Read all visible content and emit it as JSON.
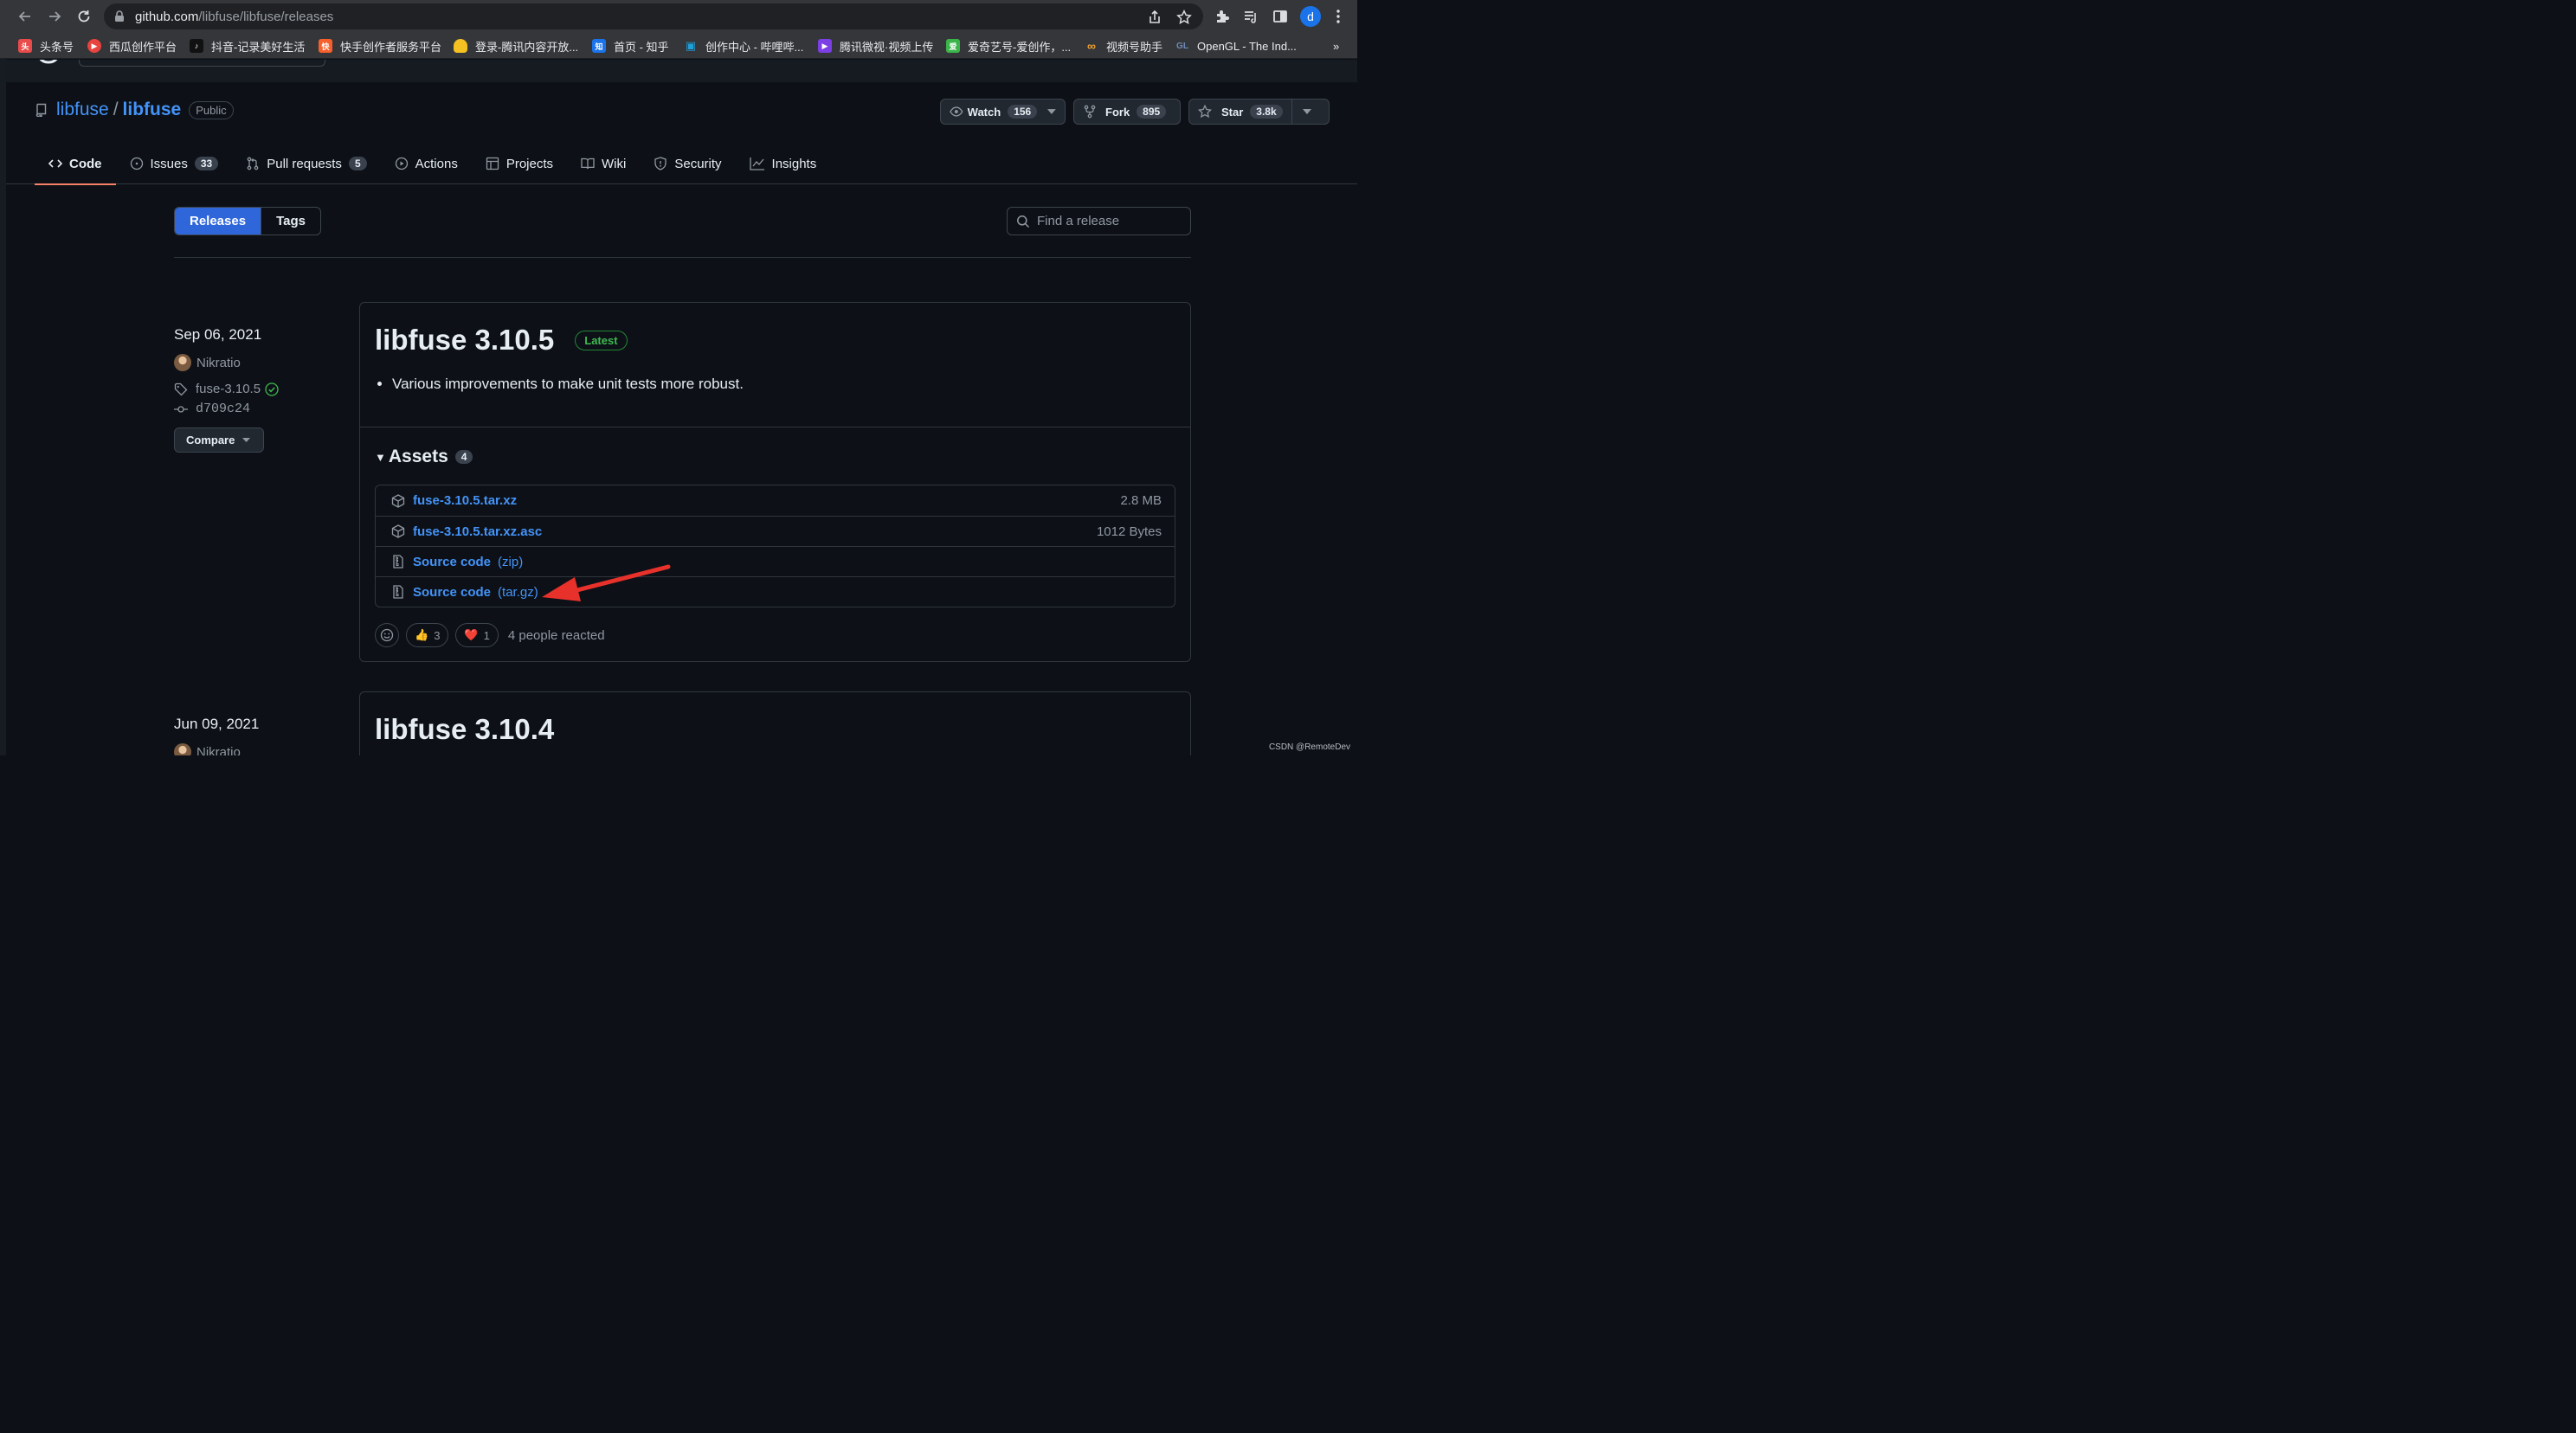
{
  "browser": {
    "url_host": "github.com",
    "url_path": "/libfuse/libfuse/releases",
    "profile_initial": "d",
    "bookmarks": [
      {
        "label": "头条号",
        "color": "#e94b4b",
        "glyph": "头"
      },
      {
        "label": "西瓜创作平台",
        "color": "#e8433e",
        "glyph": "▶"
      },
      {
        "label": "抖音-记录美好生活",
        "color": "#111111",
        "glyph": "♪"
      },
      {
        "label": "快手创作者服务平台",
        "color": "#f7602b",
        "glyph": "快"
      },
      {
        "label": "登录-腾讯内容开放...",
        "color": "#f5c021",
        "glyph": "●"
      },
      {
        "label": "首页 - 知乎",
        "color": "#1a73e8",
        "glyph": "知"
      },
      {
        "label": "创作中心 - 哔哩哔...",
        "color": "#20a0da",
        "glyph": "▣"
      },
      {
        "label": "腾讯微视·视频上传",
        "color": "#7b3fe4",
        "glyph": "▶"
      },
      {
        "label": "爱奇艺号-爱创作，...",
        "color": "#3bb54a",
        "glyph": "爱"
      },
      {
        "label": "视频号助手",
        "color": "#f0a030",
        "glyph": "∞"
      },
      {
        "label": "OpenGL - The Ind...",
        "color": "#6c8bb6",
        "glyph": "GL"
      }
    ],
    "more_bookmarks": "»"
  },
  "repo": {
    "owner": "libfuse",
    "name": "libfuse",
    "visibility": "Public",
    "watch": {
      "label": "Watch",
      "count": "156"
    },
    "fork": {
      "label": "Fork",
      "count": "895"
    },
    "star": {
      "label": "Star",
      "count": "3.8k"
    }
  },
  "tabs": [
    {
      "label": "Code",
      "icon": "code-icon",
      "selected": true
    },
    {
      "label": "Issues",
      "icon": "issue-icon",
      "count": "33"
    },
    {
      "label": "Pull requests",
      "icon": "pull-request-icon",
      "count": "5"
    },
    {
      "label": "Actions",
      "icon": "play-icon"
    },
    {
      "label": "Projects",
      "icon": "table-icon"
    },
    {
      "label": "Wiki",
      "icon": "book-icon"
    },
    {
      "label": "Security",
      "icon": "shield-icon"
    },
    {
      "label": "Insights",
      "icon": "graph-icon"
    }
  ],
  "subnav": {
    "releases": "Releases",
    "tags": "Tags",
    "search_placeholder": "Find a release"
  },
  "releases": [
    {
      "date": "Sep 06, 2021",
      "author": "Nikratio",
      "tag": "fuse-3.10.5",
      "commit": "d709c24",
      "compare": "Compare",
      "title": "libfuse 3.10.5",
      "latest_badge": "Latest",
      "notes": [
        "Various improvements to make unit tests more robust."
      ],
      "assets_label": "Assets",
      "assets_count": "4",
      "assets": [
        {
          "name": "fuse-3.10.5.tar.xz",
          "size": "2.8 MB",
          "icon": "package-icon"
        },
        {
          "name": "fuse-3.10.5.tar.xz.asc",
          "size": "1012 Bytes",
          "icon": "package-icon"
        },
        {
          "name": "Source code",
          "paren": "(zip)",
          "icon": "file-zip-icon"
        },
        {
          "name": "Source code",
          "paren": "(tar.gz)",
          "icon": "file-zip-icon"
        }
      ],
      "reactions": {
        "thumbs_up": "👍",
        "thumbs_up_count": "3",
        "heart": "❤️",
        "heart_count": "1",
        "summary": "4 people reacted"
      }
    },
    {
      "date": "Jun 09, 2021",
      "author": "Nikratio",
      "title": "libfuse 3.10.4"
    }
  ],
  "annotation": {
    "arrow_color": "#e8312a"
  },
  "watermark": "CSDN @RemoteDev"
}
